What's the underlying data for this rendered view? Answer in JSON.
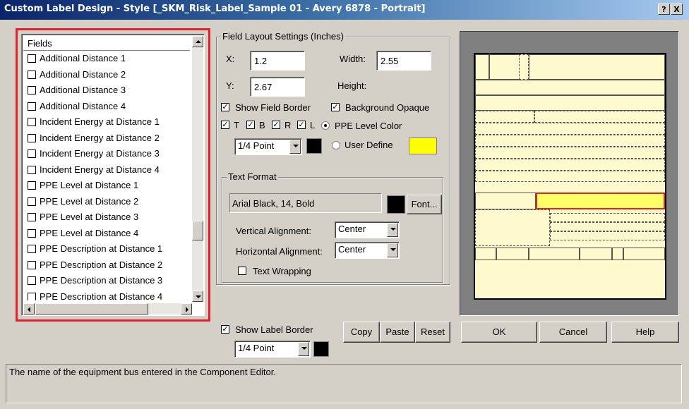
{
  "window": {
    "title": "Custom Label Design - Style [_SKM_Risk_Label_Sample 01 - Avery 6878 - Portrait]"
  },
  "titlebar_buttons": {
    "help": "?",
    "close": "X"
  },
  "fields_panel": {
    "header": "Fields",
    "items": [
      {
        "label": "Additional Distance 1",
        "checked": false
      },
      {
        "label": "Additional Distance 2",
        "checked": false
      },
      {
        "label": "Additional Distance 3",
        "checked": false
      },
      {
        "label": "Additional Distance 4",
        "checked": false
      },
      {
        "label": "Incident Energy at Distance 1",
        "checked": false
      },
      {
        "label": "Incident Energy at Distance 2",
        "checked": false
      },
      {
        "label": "Incident Energy at Distance 3",
        "checked": false
      },
      {
        "label": "Incident Energy at Distance 4",
        "checked": false
      },
      {
        "label": "PPE Level at Distance 1",
        "checked": false
      },
      {
        "label": "PPE Level at Distance 2",
        "checked": false
      },
      {
        "label": "PPE Level at Distance 3",
        "checked": false
      },
      {
        "label": "PPE Level at Distance 4",
        "checked": false
      },
      {
        "label": "PPE Description at Distance 1",
        "checked": false
      },
      {
        "label": "PPE Description at Distance 2",
        "checked": false
      },
      {
        "label": "PPE Description at Distance 3",
        "checked": false
      },
      {
        "label": "PPE Description at Distance 4",
        "checked": false
      }
    ],
    "highlight_color": "#e0232b"
  },
  "layout": {
    "group_title": "Field Layout Settings (Inches)",
    "x_label": "X:",
    "x_value": "1.2",
    "y_label": "Y:",
    "y_value": "2.67",
    "width_label": "Width:",
    "width_value": "2.55",
    "height_label": "Height:",
    "show_field_border": "Show Field Border",
    "background_opaque": "Background Opaque",
    "border_t": "T",
    "border_b": "B",
    "border_r": "R",
    "border_l": "L",
    "ppe_level_color": "PPE Level Color",
    "user_define": "User Define",
    "border_width": "1/4 Point",
    "user_define_color": "#ffff00",
    "border_color": "#000000"
  },
  "text_format": {
    "group_title": "Text Format",
    "font_display": "Arial Black, 14, Bold",
    "font_button": "Font...",
    "font_color": "#000000",
    "vertical_label": "Vertical Alignment:",
    "vertical_value": "Center",
    "horizontal_label": "Horizontal Alignment:",
    "horizontal_value": "Center",
    "text_wrapping": "Text Wrapping"
  },
  "label_border": {
    "show_label_border": "Show Label Border",
    "width": "1/4 Point",
    "color": "#000000"
  },
  "actions": {
    "copy": "Copy",
    "paste": "Paste",
    "reset": "Reset",
    "ok": "OK",
    "cancel": "Cancel",
    "help": "Help"
  },
  "status": {
    "text": "The name of the equipment bus entered in the Component Editor."
  },
  "preview": {
    "background": "#fffacd",
    "selected_field_color": "#ffff66",
    "selected_border": "#e0232b"
  }
}
